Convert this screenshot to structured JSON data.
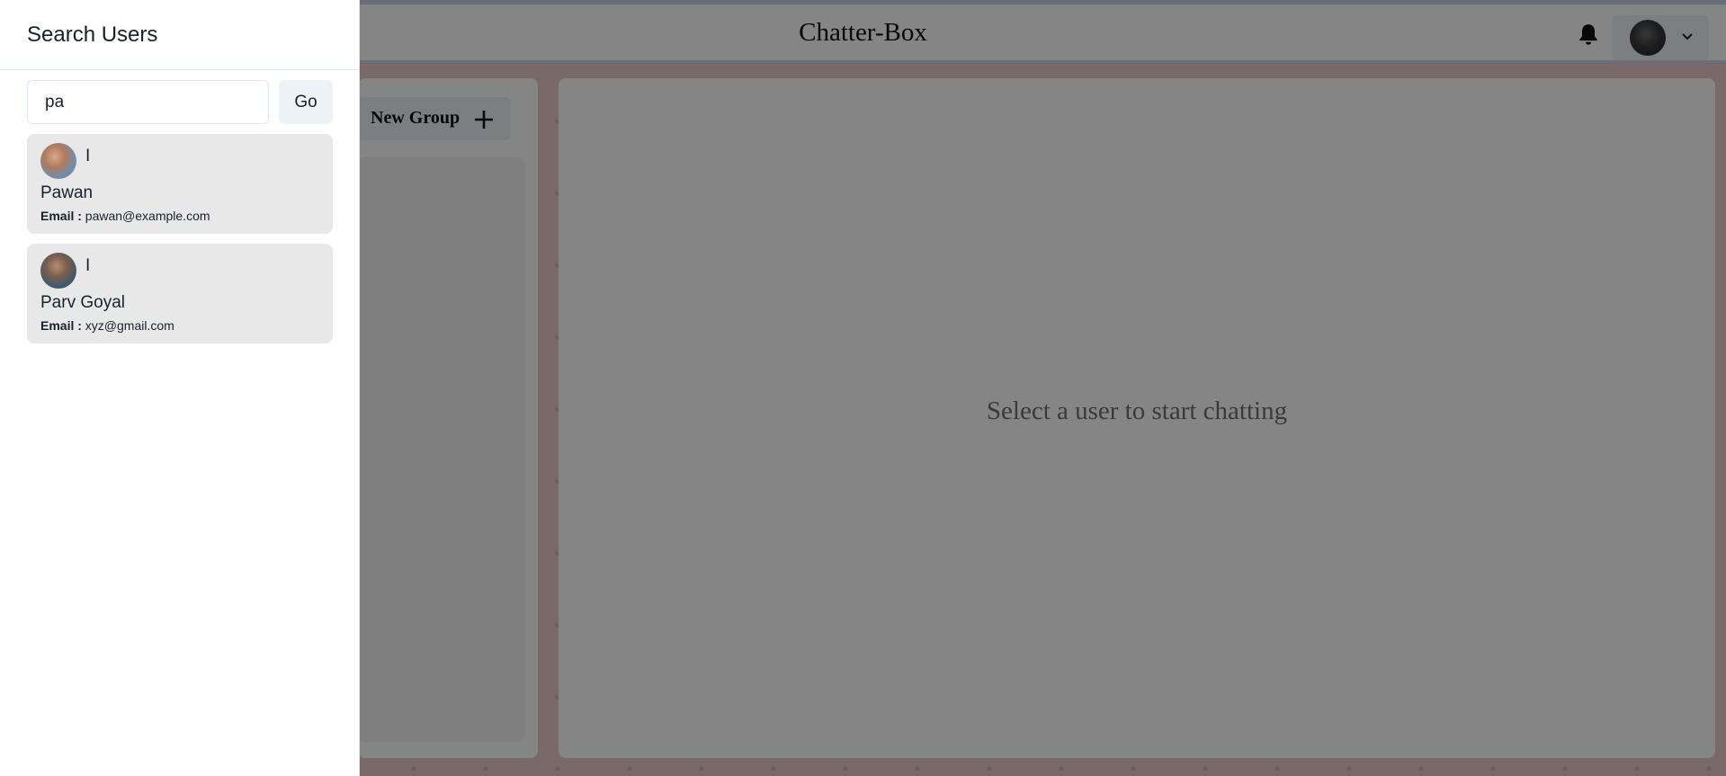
{
  "header": {
    "app_title": "Chatter-Box"
  },
  "sidebar": {
    "new_group_label": "New Group"
  },
  "chat": {
    "empty_message": "Select a user to start chatting"
  },
  "drawer": {
    "title": "Search Users",
    "search": {
      "value": "pa"
    },
    "go_label": "Go",
    "email_label": "Email :",
    "results": [
      {
        "initial": "I",
        "name": "Pawan",
        "email": "pawan@example.com"
      },
      {
        "initial": "I",
        "name": "Parv Goyal",
        "email": "xyz@gmail.com"
      }
    ]
  },
  "colors": {
    "header_bg": "#ffffff",
    "button_bg": "#edf2f7",
    "result_card_bg": "#e8e8e8",
    "overlay": "rgba(0,0,0,0.48)"
  },
  "icons": [
    "bell-icon",
    "chevron-down-icon",
    "plus-icon",
    "avatar"
  ]
}
